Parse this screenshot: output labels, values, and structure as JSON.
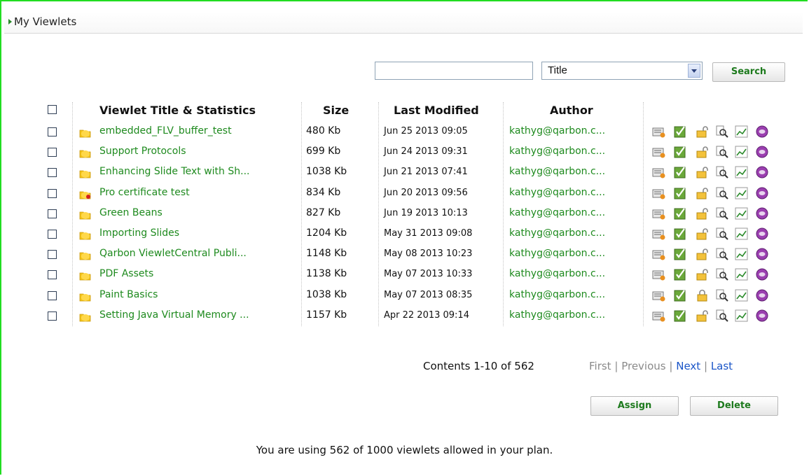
{
  "section": {
    "title": "My Viewlets"
  },
  "search": {
    "query": "",
    "field_selected": "Title",
    "button_label": "Search"
  },
  "table": {
    "headers": {
      "title": "Viewlet Title & Statistics",
      "size": "Size",
      "modified": "Last Modified",
      "author": "Author"
    },
    "rows": [
      {
        "title": "embedded_FLV_buffer_test",
        "size": "480 Kb",
        "modified": "Jun 25 2013 09:05",
        "author": "kathyg@qarbon.c...",
        "folder": "folder",
        "lock": "unlocked"
      },
      {
        "title": "Support Protocols",
        "size": "699 Kb",
        "modified": "Jun 24 2013 09:31",
        "author": "kathyg@qarbon.c...",
        "folder": "folder",
        "lock": "unlocked"
      },
      {
        "title": "Enhancing Slide Text with Sh...",
        "size": "1038 Kb",
        "modified": "Jun 21 2013 07:41",
        "author": "kathyg@qarbon.c...",
        "folder": "folder",
        "lock": "unlocked"
      },
      {
        "title": "Pro certificate test",
        "size": "834 Kb",
        "modified": "Jun 20 2013 09:56",
        "author": "kathyg@qarbon.c...",
        "folder": "certificate-folder",
        "lock": "unlocked"
      },
      {
        "title": "Green Beans",
        "size": "827 Kb",
        "modified": "Jun 19 2013 10:13",
        "author": "kathyg@qarbon.c...",
        "folder": "folder",
        "lock": "unlocked"
      },
      {
        "title": "Importing Slides",
        "size": "1204 Kb",
        "modified": "May 31 2013 09:08",
        "author": "kathyg@qarbon.c...",
        "folder": "folder",
        "lock": "unlocked"
      },
      {
        "title": "Qarbon ViewletCentral Publi...",
        "size": "1148 Kb",
        "modified": "May 08 2013 10:23",
        "author": "kathyg@qarbon.c...",
        "folder": "folder",
        "lock": "unlocked"
      },
      {
        "title": "PDF Assets",
        "size": "1138 Kb",
        "modified": "May 07 2013 10:33",
        "author": "kathyg@qarbon.c...",
        "folder": "folder",
        "lock": "unlocked"
      },
      {
        "title": "Paint Basics",
        "size": "1038 Kb",
        "modified": "May 07 2013 08:35",
        "author": "kathyg@qarbon.c...",
        "folder": "folder",
        "lock": "locked"
      },
      {
        "title": "Setting Java Virtual Memory ...",
        "size": "1157 Kb",
        "modified": "Apr 22 2013 09:14",
        "author": "kathyg@qarbon.c...",
        "folder": "folder",
        "lock": "unlocked"
      }
    ]
  },
  "pager": {
    "contents": "Contents 1-10 of 562",
    "first": "First",
    "previous": "Previous",
    "next": "Next",
    "last": "Last",
    "separator": "|"
  },
  "actions": {
    "assign_label": "Assign",
    "delete_label": "Delete"
  },
  "usage_text": "You are using 562 of 1000 viewlets allowed in your plan.",
  "colors": {
    "frame": "#22dd22",
    "link_green": "#1e8a1e",
    "link_blue": "#1a55c8",
    "disabled": "#8a8a8a"
  }
}
